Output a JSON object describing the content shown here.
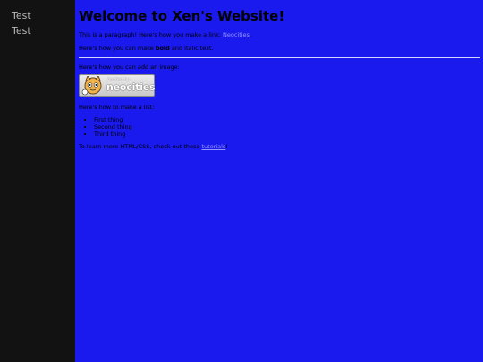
{
  "sidebar": {
    "items": [
      {
        "label": "Test"
      },
      {
        "label": "Test"
      }
    ]
  },
  "main": {
    "title": "Welcome to Xen's Website!",
    "p1_text": "This is a paragraph! Here's how you make a link: ",
    "p1_link": "Neocities",
    "p1_end": ".",
    "p2_pre": "Here's how you can make ",
    "p2_bold": "bold",
    "p2_post": " and italic text.",
    "p3_text": "Here's how you can add an image:",
    "badge": {
      "small": "hosted by",
      "big": "neocities"
    },
    "p4_text": "Here's how to make a list:",
    "list": [
      "First thing",
      "Second thing",
      "Third thing"
    ],
    "p5_pre": "To learn more HTML/CSS, check out these ",
    "p5_link": "tutorials",
    "p5_end": "!"
  },
  "colors": {
    "background": "#1a1aee",
    "sidebar": "#121212",
    "sidebar_text": "#b8b8b8",
    "link": "#9696ff"
  }
}
